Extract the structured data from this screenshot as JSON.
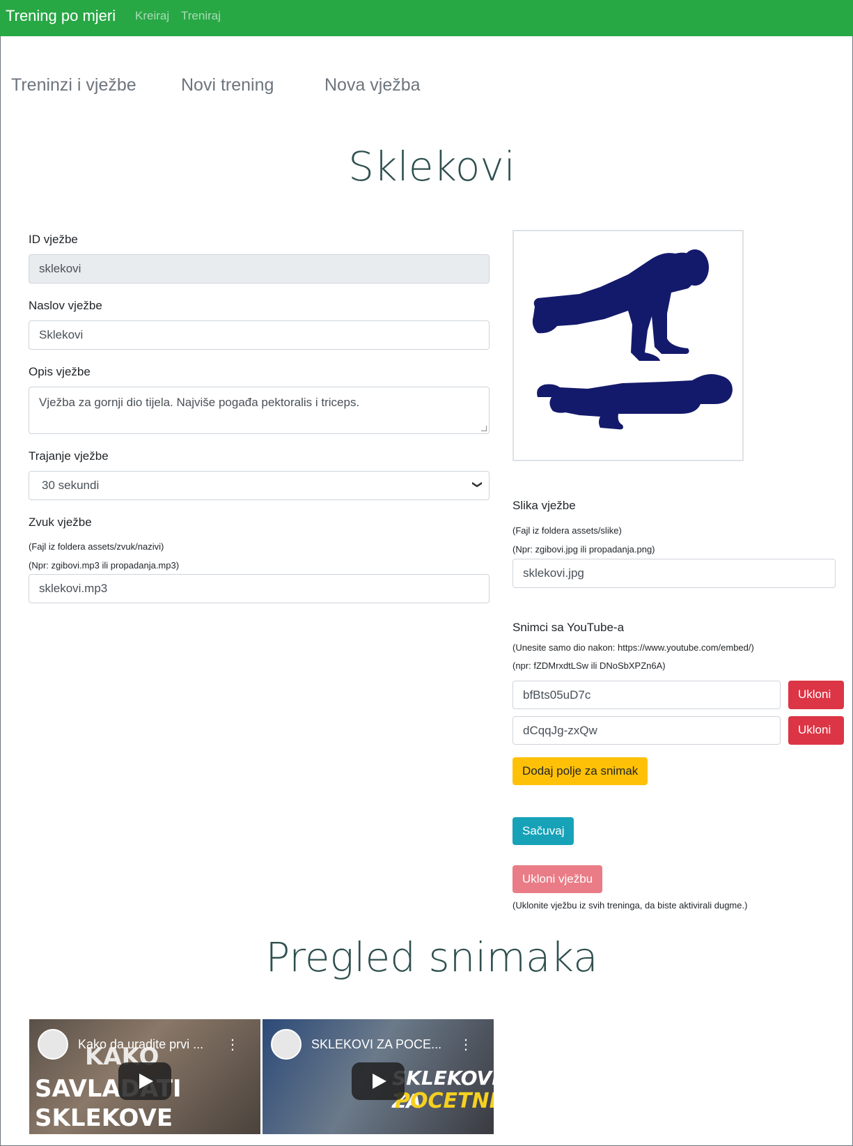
{
  "navbar": {
    "brand": "Trening po mjeri",
    "links": [
      "Kreiraj",
      "Treniraj"
    ]
  },
  "tabs": [
    "Treninzi i vježbe",
    "Novi trening",
    "Nova vježba"
  ],
  "page_title": "Sklekovi",
  "form": {
    "id_label": "ID vježbe",
    "id_value": "sklekovi",
    "naslov_label": "Naslov vježbe",
    "naslov_value": "Sklekovi",
    "opis_label": "Opis vježbe",
    "opis_value": "Vježba za gornji dio tijela. Najviše pogađa pektoralis i triceps.",
    "trajanje_label": "Trajanje vježbe",
    "trajanje_value": "30 sekundi",
    "zvuk_label": "Zvuk vježbe",
    "zvuk_hint1": "(Fajl iz foldera assets/zvuk/nazivi)",
    "zvuk_hint2": "(Npr: zgibovi.mp3 ili propadanja.mp3)",
    "zvuk_value": "sklekovi.mp3",
    "slika_label": "Slika vježbe",
    "slika_hint1": "(Fajl iz foldera assets/slike)",
    "slika_hint2": "(Npr: zgibovi.jpg ili propadanja.png)",
    "slika_value": "sklekovi.jpg",
    "yt_label": "Snimci sa YouTube-a",
    "yt_hint1": "(Unesite samo dio nakon: https://www.youtube.com/embed/)",
    "yt_hint2": "(npr: fZDMrxdtLSw ili DNoSbXPZn6A)",
    "yt_values": [
      "bfBts05uD7c",
      "dCqqJg-zxQw"
    ],
    "remove_label": "Ukloni",
    "add_field_label": "Dodaj polje za snimak",
    "save_label": "Sačuvaj",
    "delete_label": "Ukloni vježbu",
    "delete_hint": "(Uklonite vježbu iz svih treninga, da biste aktivirali dugme.)"
  },
  "videos_title": "Pregled snimaka",
  "videos": [
    {
      "title": "Kako da uradite prvi ...",
      "overlay": [
        "KAKO",
        "SAVLADATI",
        "SKLEKOVE"
      ]
    },
    {
      "title": "SKLEKOVI ZA POCE...",
      "overlay": [
        "SKLEKOVI ZA",
        "POCETNIKE"
      ]
    }
  ],
  "colors": {
    "navbar": "#28a745",
    "danger": "#dc3545",
    "warning": "#ffc107",
    "info": "#17a2b8",
    "silhouette": "#141a6b",
    "heading": "#2f4f4f"
  }
}
